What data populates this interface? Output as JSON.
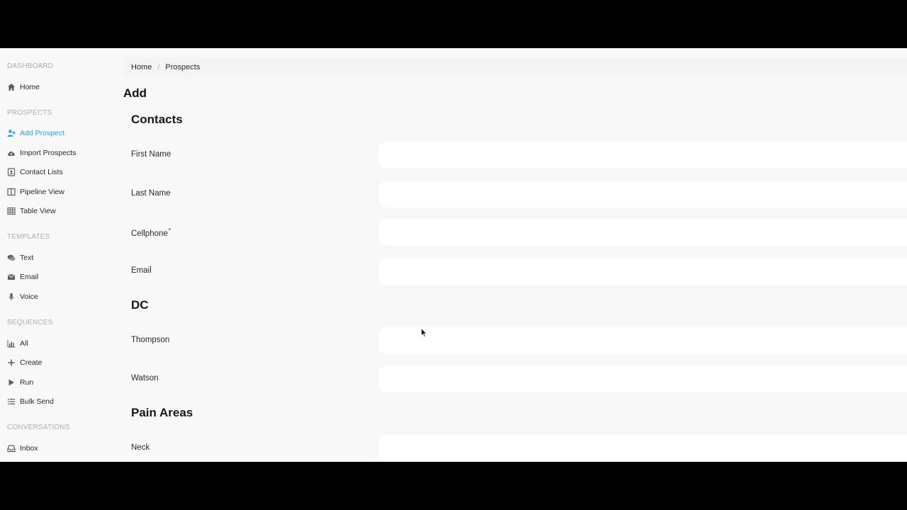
{
  "sidebar": {
    "sections": [
      {
        "title": "DASHBOARD"
      },
      {
        "title": "PROSPECTS"
      },
      {
        "title": "TEMPLATES"
      },
      {
        "title": "SEQUENCES"
      },
      {
        "title": "CONVERSATIONS"
      }
    ],
    "items": [
      {
        "label": "Home",
        "icon": "home-icon"
      },
      {
        "label": "Add Prospect",
        "icon": "add-user-icon"
      },
      {
        "label": "Import Prospects",
        "icon": "cloud-upload-icon"
      },
      {
        "label": "Contact Lists",
        "icon": "contact-book-icon"
      },
      {
        "label": "Pipeline View",
        "icon": "columns-icon"
      },
      {
        "label": "Table View",
        "icon": "table-icon"
      },
      {
        "label": "Text",
        "icon": "chat-icon"
      },
      {
        "label": "Email",
        "icon": "envelope-icon"
      },
      {
        "label": "Voice",
        "icon": "microphone-icon"
      },
      {
        "label": "All",
        "icon": "bar-chart-icon"
      },
      {
        "label": "Create",
        "icon": "plus-icon"
      },
      {
        "label": "Run",
        "icon": "play-icon"
      },
      {
        "label": "Bulk Send",
        "icon": "list-icon"
      },
      {
        "label": "Inbox",
        "icon": "inbox-icon"
      }
    ],
    "active_color": "#2aa3d8"
  },
  "breadcrumb": {
    "home": "Home",
    "separator": "/",
    "current": "Prospects"
  },
  "page_title": "Add",
  "form": {
    "sections": [
      {
        "heading": "Contacts"
      },
      {
        "heading": "DC"
      },
      {
        "heading": "Pain Areas"
      }
    ],
    "fields": [
      {
        "label": "First Name",
        "value": ""
      },
      {
        "label": "Last Name",
        "value": ""
      },
      {
        "label": "Cellphone",
        "required_mark": "*",
        "value": ""
      },
      {
        "label": "Email",
        "value": ""
      },
      {
        "label": "Thompson",
        "value": ""
      },
      {
        "label": "Watson",
        "value": ""
      },
      {
        "label": "Neck",
        "value": ""
      }
    ]
  }
}
